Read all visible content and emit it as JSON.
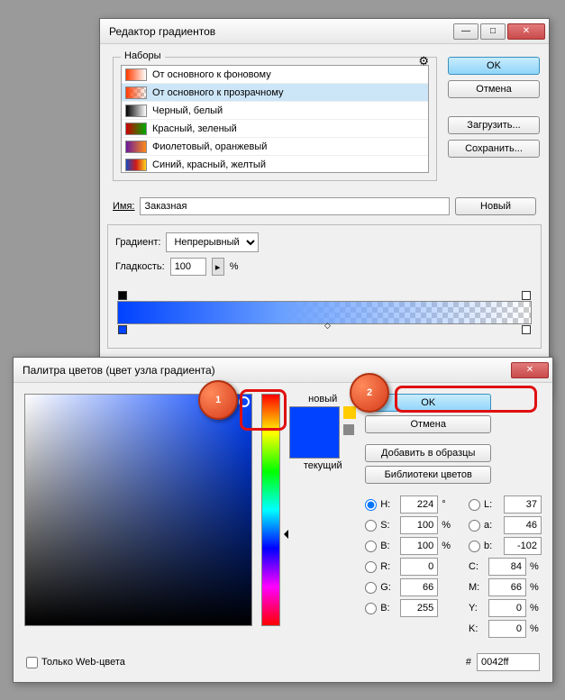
{
  "gradEditor": {
    "title": "Редактор градиентов",
    "presetsLabel": "Наборы",
    "ok": "OK",
    "cancel": "Отмена",
    "load": "Загрузить...",
    "save": "Сохранить...",
    "nameLabel": "Имя:",
    "nameValue": "Заказная",
    "new": "Новый",
    "gradientLabel": "Градиент:",
    "gradientType": "Непрерывный",
    "smoothLabel": "Гладкость:",
    "smoothValue": "100",
    "pct": "%",
    "presets": [
      {
        "label": "От основного к фоновому",
        "g": "linear-gradient(to right,#ff3b00,#fff)"
      },
      {
        "label": "От основного к прозрачному",
        "g": "linear-gradient(to right,#ff3b00,transparent),repeating-conic-gradient(#ccc 0 25%,#fff 0 50%) 0/8px 8px"
      },
      {
        "label": "Черный, белый",
        "g": "linear-gradient(to right,#000,#fff)"
      },
      {
        "label": "Красный, зеленый",
        "g": "linear-gradient(to right,#c00,#0a0)"
      },
      {
        "label": "Фиолетовый, оранжевый",
        "g": "linear-gradient(to right,#6a1a9a,#ff8c1a)"
      },
      {
        "label": "Синий, красный, желтый",
        "g": "linear-gradient(to right,#1a4ac0,#d01a1a,#ffd21a)"
      }
    ]
  },
  "colorPicker": {
    "title": "Палитра цветов (цвет узла градиента)",
    "ok": "OK",
    "cancel": "Отмена",
    "addSwatch": "Добавить в образцы",
    "libraries": "Библиотеки цветов",
    "new": "новый",
    "current": "текущий",
    "webOnly": "Только Web-цвета",
    "hash": "#",
    "hex": "0042ff",
    "deg": "°",
    "pct": "%",
    "H": "H:",
    "Hval": "224",
    "S": "S:",
    "Sval": "100",
    "B": "B:",
    "Bval": "100",
    "R": "R:",
    "Rval": "0",
    "G": "G:",
    "Gval": "66",
    "Bl": "B:",
    "Blval": "255",
    "L": "L:",
    "Lval": "37",
    "a": "a:",
    "aval": "46",
    "bl": "b:",
    "blval": "-102",
    "C": "C:",
    "Cval": "84",
    "M": "M:",
    "Mval": "66",
    "Y": "Y:",
    "Yval": "0",
    "K": "K:",
    "Kval": "0"
  },
  "markers": {
    "one": "1",
    "two": "2"
  }
}
